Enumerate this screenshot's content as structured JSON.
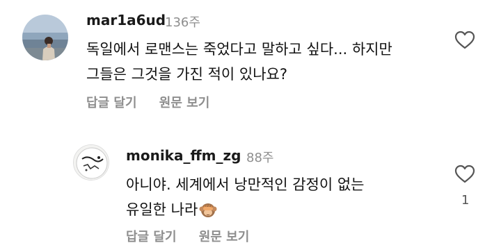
{
  "comments": [
    {
      "username": "mar1a6ud",
      "time": "136주",
      "lines": [
        "독일에서 로맨스는 죽었다고 말하고 싶다... 하지만",
        "그들은 그것을 가진 적이 있나요?"
      ],
      "reply_label": "답글 달기",
      "translate_label": "원문 보기",
      "like_count": ""
    },
    {
      "username": "monika_ffm_zg",
      "time": "88주",
      "lines": [
        "아니야. 세계에서 낭만적인 감정이 없는",
        "유일한 나라"
      ],
      "emoji": "see-no-evil-monkey",
      "reply_label": "답글 달기",
      "translate_label": "원문 보기",
      "like_count": "1"
    }
  ],
  "colors": {
    "text": "#111111",
    "secondary": "#8e8e8e",
    "background": "#ffffff"
  }
}
